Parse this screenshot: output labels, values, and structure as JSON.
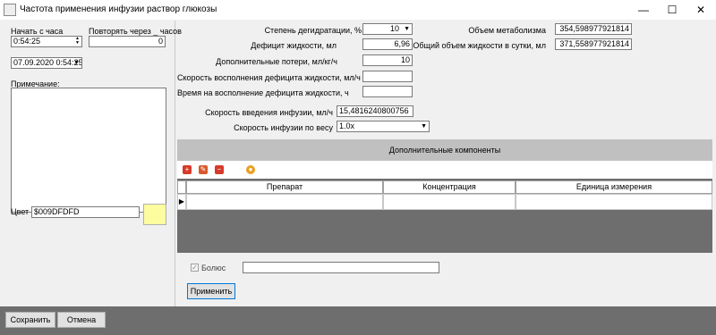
{
  "window": {
    "title": "Частота применения инфузии раствор глюкозы",
    "minimize": "—",
    "maximize": "☐",
    "close": "✕"
  },
  "left": {
    "start_label": "Начать с часа",
    "start_value": "0:54:25",
    "repeat_label": "Повторять через _ часов",
    "repeat_value": "0",
    "datetime_value": "07.09.2020 0:54:25",
    "note_label": "Примечание:",
    "note_value": "",
    "color_label": "Цвет",
    "color_value": "$009DFDFD",
    "swatch_color": "#FDFDA0"
  },
  "form": {
    "dehydration_label": "Степень дегидратации, %",
    "dehydration_value": "10",
    "fluid_deficit_label": "Дефицит жидкости, мл",
    "fluid_deficit_value": "6,96",
    "extra_losses_label": "Дополнительные потери, мл/кг/ч",
    "extra_losses_value": "10",
    "deficit_rate_label": "Скорость восполнения дефицита жидкости, мл/ч",
    "deficit_rate_value": "",
    "deficit_time_label": "Время на восполнение дефицита жидкости, ч",
    "deficit_time_value": "",
    "infusion_rate_label": "Скорость введения инфузии, мл/ч",
    "infusion_rate_value": "15,4816240800756",
    "weight_rate_label": "Скорость инфузии по весу",
    "weight_rate_value": "1.0x",
    "metabolism_label": "Объем метаболизма",
    "metabolism_value": "354,598977921814",
    "total_volume_label": "Общий объем жидкости в сутки, мл",
    "total_volume_value": "371,558977921814"
  },
  "components": {
    "header": "Дополнительные компоненты",
    "columns": [
      "Препарат",
      "Концентрация",
      "Единица измерения"
    ],
    "row_indicator": "▶"
  },
  "bolus": {
    "label": "Болюс",
    "value": ""
  },
  "buttons": {
    "apply": "Применить",
    "save": "Сохранить",
    "cancel": "Отмена"
  }
}
